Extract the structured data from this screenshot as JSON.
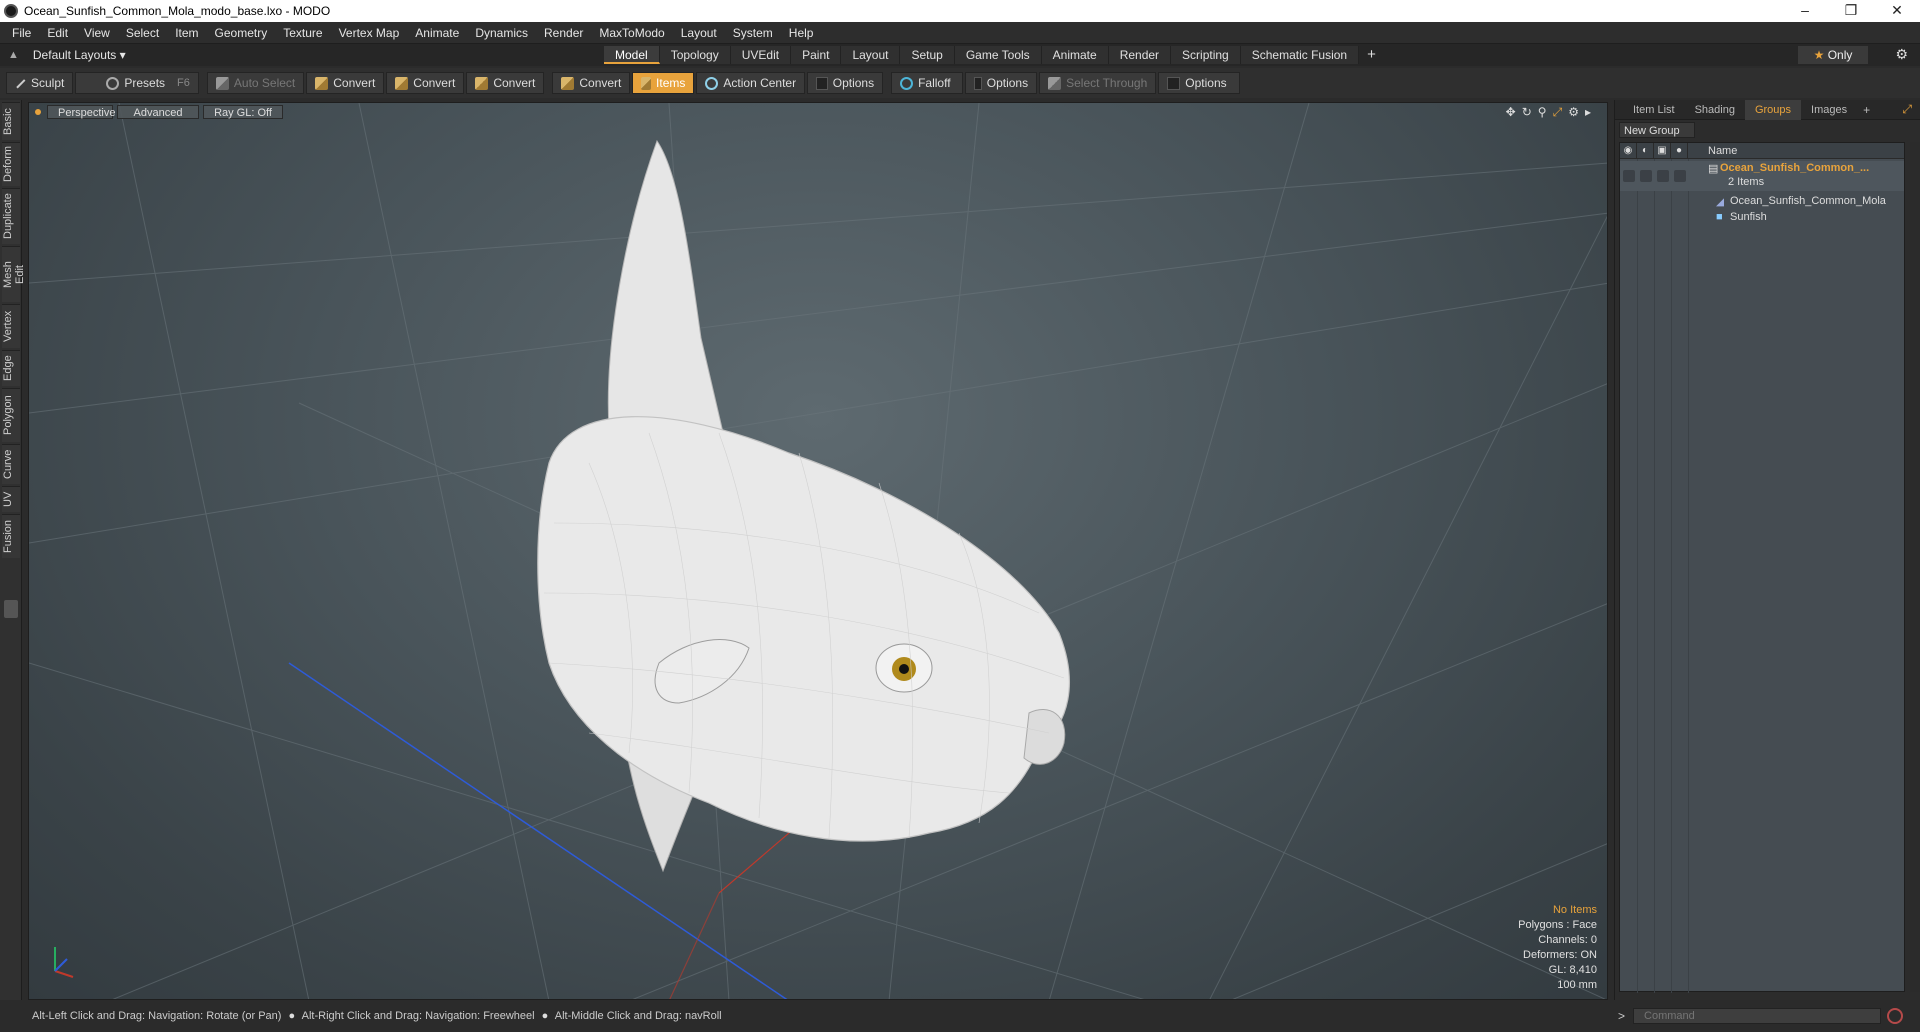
{
  "window": {
    "title": "Ocean_Sunfish_Common_Mola_modo_base.lxo - MODO",
    "minimize": "–",
    "maximize": "❐",
    "close": "✕"
  },
  "menu": [
    "File",
    "Edit",
    "View",
    "Select",
    "Item",
    "Geometry",
    "Texture",
    "Vertex Map",
    "Animate",
    "Dynamics",
    "Render",
    "MaxToModo",
    "Layout",
    "System",
    "Help"
  ],
  "layouts": {
    "label": "Default Layouts ▾",
    "tabs": [
      "Model",
      "Topology",
      "UVEdit",
      "Paint",
      "Layout",
      "Setup",
      "Game Tools",
      "Animate",
      "Render",
      "Scripting",
      "Schematic Fusion"
    ],
    "active_tab": "Model",
    "only_star": "★",
    "only_label": "Only",
    "gear": "⚙"
  },
  "toolbar": {
    "sculpt": "Sculpt",
    "presets": "Presets",
    "presets_key": "F6",
    "auto_select": "Auto Select",
    "convert1": "Convert",
    "convert2": "Convert",
    "convert3": "Convert",
    "convert4": "Convert",
    "items": "Items",
    "action_center": "Action Center",
    "options1": "Options",
    "falloff": "Falloff",
    "options2": "Options",
    "select_through": "Select Through",
    "options3": "Options"
  },
  "left_tabs": [
    "Basic",
    "Deform",
    "Duplicate",
    "Mesh Edit",
    "Vertex",
    "Edge",
    "Polygon",
    "Curve",
    "UV",
    "Fusion"
  ],
  "viewport": {
    "view_mode": "Perspective",
    "shading": "Advanced",
    "raygl": "Ray GL: Off",
    "info": {
      "selection": "No Items",
      "polygons": "Polygons : Face",
      "channels": "Channels: 0",
      "deformers": "Deformers: ON",
      "gl": "GL: 8,410",
      "scale": "100 mm"
    },
    "colors": {
      "bg_center": "#5e6a70",
      "fish_body": "#e4e4e4",
      "eye_iris": "#b08a1c",
      "axis_x": "#c0392b",
      "axis_y": "#27ae60",
      "axis_z": "#2e5bd8"
    }
  },
  "right_panel": {
    "tabs": [
      "Item List",
      "Shading",
      "Groups",
      "Images"
    ],
    "active_tab": "Groups",
    "new_group": "New Group",
    "column_name": "Name",
    "group": {
      "name": "Ocean_Sunfish_Common_...",
      "count": "2 Items",
      "children": [
        "Ocean_Sunfish_Common_Mola",
        "Sunfish"
      ]
    }
  },
  "status": {
    "hint1": "Alt-Left Click and Drag: Navigation: Rotate (or Pan)",
    "hint2": "Alt-Right Click and Drag: Navigation: Freewheel",
    "hint3": "Alt-Middle Click and Drag: navRoll",
    "bullet": "●"
  },
  "command": {
    "placeholder": "Command",
    "caret": ">"
  }
}
